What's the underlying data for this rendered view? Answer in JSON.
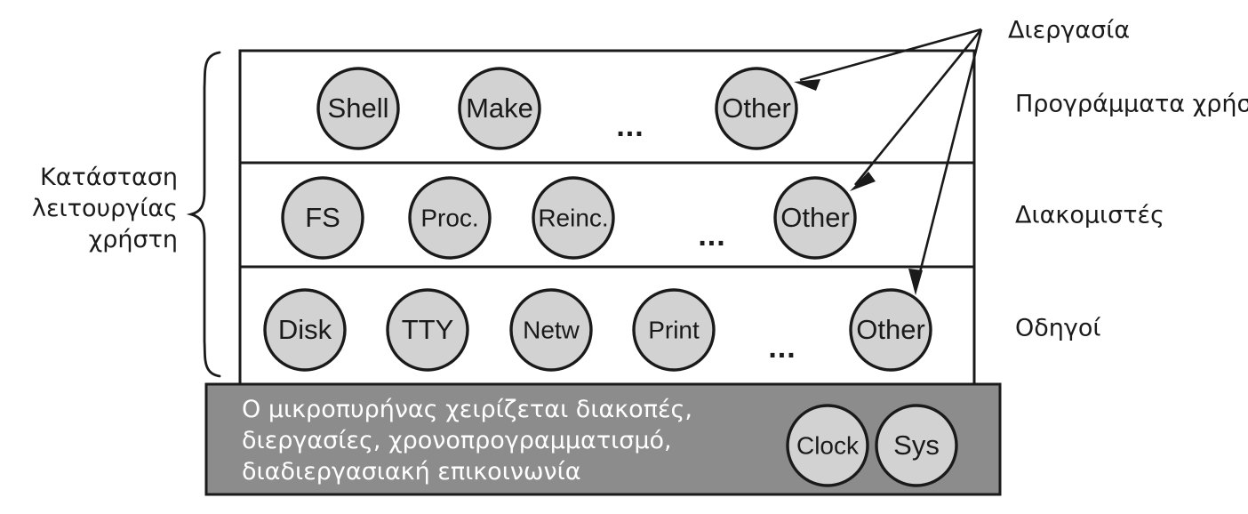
{
  "diagram": {
    "title_unlabeled": true,
    "colors": {
      "node_fill": "#d2d2d2",
      "kernel_fill": "#8c8c8c",
      "stroke": "#1a1a1a",
      "layer_fill": "#ffffff",
      "kernel_text": "#ffffff"
    },
    "left_brace_label": {
      "line1": "Κατάσταση",
      "line2": "λειτουργίας",
      "line3": "χρήστη"
    },
    "callout_label": "Διεργασία",
    "layers": [
      {
        "id": "user-programs",
        "right_label": "Προγράμματα χρήστη",
        "nodes": [
          "Shell",
          "Make",
          "Other"
        ],
        "ellipsis": "..."
      },
      {
        "id": "servers",
        "right_label": "Διακομιστές",
        "nodes": [
          "FS",
          "Proc.",
          "Reinc.",
          "Other"
        ],
        "ellipsis": "..."
      },
      {
        "id": "drivers",
        "right_label": "Οδηγοί",
        "nodes": [
          "Disk",
          "TTY",
          "Netw",
          "Print",
          "Other"
        ],
        "ellipsis": "..."
      }
    ],
    "kernel": {
      "id": "microkernel",
      "text_line1": "Ο μικροπυρήνας χειρίζεται διακοπές,",
      "text_line2": "διεργασίες, χρονοπρογραμματισμό,",
      "text_line3": "διαδιεργασιακή επικοινωνία",
      "nodes": [
        "Clock",
        "Sys"
      ]
    }
  }
}
